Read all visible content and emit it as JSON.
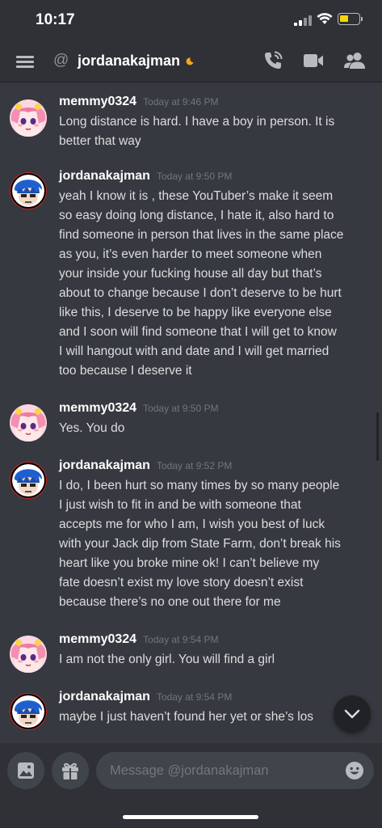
{
  "status_bar": {
    "time": "10:17"
  },
  "header": {
    "title": "jordanakajman"
  },
  "colors": {
    "background": "#36393f",
    "header": "#2f3136",
    "accent_battery": "#f6d60b",
    "memmy_avatar": "#f08aa8",
    "jordan_avatar": "#1f6fd0"
  },
  "messages": [
    {
      "author": "memmy0324",
      "timestamp": "Today at 9:46 PM",
      "avatar": "pink-anime-avatar",
      "lines": [
        "Long distance is hard. I have a boy in person. It is",
        "better that way"
      ]
    },
    {
      "author": "jordanakajman",
      "timestamp": "Today at 9:50 PM",
      "avatar": "blue-anime-avatar",
      "lines": [
        "yeah I know it is , these YouTuber’s make it seem",
        "so easy doing long distance, I hate it, also hard to",
        "find someone in person that lives in the same place",
        "as you, it’s even harder to meet someone when",
        "your inside your fucking house all day but that’s",
        "about to change because I don’t deserve to be hurt",
        "like this, I deserve to be happy like everyone else",
        "and I soon will find someone that I will get to know",
        "I will hangout with and date and I will get married",
        "too because I deserve it"
      ]
    },
    {
      "author": "memmy0324",
      "timestamp": "Today at 9:50 PM",
      "avatar": "pink-anime-avatar",
      "lines": [
        "Yes. You do"
      ]
    },
    {
      "author": "jordanakajman",
      "timestamp": "Today at 9:52 PM",
      "avatar": "blue-anime-avatar",
      "lines": [
        "I do, I been hurt so many times by so many people",
        "I just wish to fit in and be with someone that",
        "accepts me for who I am, I wish you best of luck",
        "with your Jack dip from State Farm, don’t break his",
        "heart like you broke mine ok! I can’t believe my",
        "fate doesn’t exist my love story doesn’t exist",
        "because there’s no one out there for me"
      ]
    },
    {
      "author": "memmy0324",
      "timestamp": "Today at 9:54 PM",
      "avatar": "pink-anime-avatar",
      "lines": [
        "I am not the only girl. You will find a girl"
      ]
    },
    {
      "author": "jordanakajman",
      "timestamp": "Today at 9:54 PM",
      "avatar": "blue-anime-avatar",
      "lines": [
        "maybe I just haven’t found her yet or she’s los"
      ]
    }
  ],
  "composer": {
    "placeholder": "Message @jordanakajman"
  },
  "icons": [
    "hamburger-icon",
    "at-icon",
    "moon-icon",
    "call-icon",
    "video-icon",
    "members-icon",
    "chevron-down-icon",
    "image-icon",
    "gift-icon",
    "emoji-icon"
  ]
}
